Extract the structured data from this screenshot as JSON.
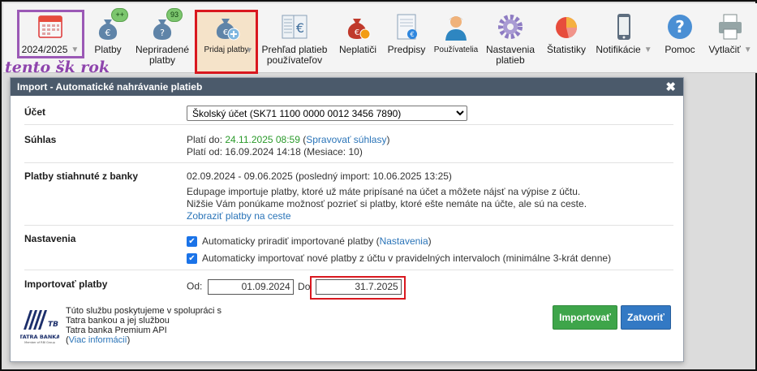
{
  "toolbar": {
    "year": "2024/2025",
    "items": [
      {
        "label": "Platby",
        "badge": "++",
        "icon": "money-bag-euro-icon"
      },
      {
        "label": "Nepriradené\nplatby",
        "badge": "93",
        "icon": "money-bag-question-icon"
      },
      {
        "label": "Pridaj platby",
        "icon": "money-bag-plus-icon"
      },
      {
        "label": "Prehľad platieb\npoužívateľov",
        "icon": "ledger-euro-icon"
      },
      {
        "label": "Neplatiči",
        "icon": "money-bag-clock-icon"
      },
      {
        "label": "Predpisy",
        "icon": "document-euro-icon"
      },
      {
        "label": "Používatelia",
        "icon": "user-icon"
      },
      {
        "label": "Nastavenia\nplatieb",
        "icon": "gear-icon"
      },
      {
        "label": "Štatistiky",
        "icon": "pie-chart-icon"
      },
      {
        "label": "Notifikácie",
        "icon": "phone-icon"
      },
      {
        "label": "Pomoc",
        "icon": "help-icon"
      },
      {
        "label": "Vytlačiť",
        "icon": "printer-icon"
      }
    ]
  },
  "annotation": "tento šk rok",
  "dialog": {
    "title": "Import - Automatické nahrávanie platieb",
    "account": {
      "label": "Účet",
      "selected": "Školský účet (SK71 1100 0000 0012 3456 7890)"
    },
    "consent": {
      "label": "Súhlas",
      "valid_to_prefix": "Platí do: ",
      "valid_to_date": "24.11.2025 08:59",
      "manage_link": "Spravovať súhlasy",
      "valid_from": "Platí od: 16.09.2024 14:18 (Mesiace: 10)"
    },
    "downloaded": {
      "label": "Platby stiahnuté z banky",
      "range": "02.09.2024 - 09.06.2025 (posledný import: 10.06.2025 13:25)",
      "info_line1": "Edupage importuje platby, ktoré už máte pripísané na účet a môžete nájsť na výpise z účtu.",
      "info_line2": "Nižšie Vám ponúkame možnosť pozrieť si platby, ktoré ešte nemáte na účte, ale sú na ceste.",
      "link": "Zobraziť platby na ceste"
    },
    "settings": {
      "label": "Nastavenia",
      "auto_assign_text": "Automaticky priradiť importované platby (",
      "auto_assign_link": "Nastavenia",
      "auto_assign_suffix": ")",
      "auto_import_text": "Automaticky importovať nové platby z účtu v pravidelných intervaloch (minimálne 3-krát denne)"
    },
    "import": {
      "label": "Importovať platby",
      "from_label": "Od:",
      "from_value": "01.09.2024",
      "to_label": "Do",
      "to_value": "31.7.2025"
    },
    "footer": {
      "line1": "Túto službu poskytujeme v spolupráci s",
      "line2": "Tatra bankou a jej službou",
      "line3": "Tatra banka Premium API",
      "link": "Viac informácií",
      "logo_text": "TATRA BANKA",
      "logo_sub": "Member of RBI Group"
    },
    "buttons": {
      "import": "Importovať",
      "close": "Zatvoriť"
    }
  }
}
